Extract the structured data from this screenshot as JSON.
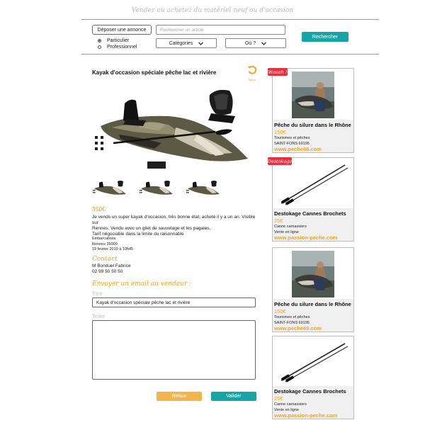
{
  "header": {
    "tagline": "Vendez ou achetez du matériel neuf ou d'occasion",
    "post_ad_label": "Déposer une annonce",
    "search_placeholder": "Rechercher un article",
    "search_button": "Rechercher",
    "category_label": "Catégories",
    "location_label": "Où ?",
    "radio_options": [
      "Particulier",
      "Professionnel"
    ],
    "selected_radio": "Particulier"
  },
  "listing": {
    "title": "Kayak d'occasion spéciale pêche lac et rivière",
    "back_label": "Retour",
    "price": "350€",
    "description": [
      "Je vends un super kayak d'occasion, très bonne état, acheté il y a un an. Visible sur",
      "Rennes. Vendu avec un gilet de sauvetage et les pagaies.",
      "Tarif négociable dans la limite du raisonnable"
    ],
    "category": "Embarcations",
    "location": "Rennes 35000",
    "date": "19 fevrier 2019 à 10h45",
    "contact_heading": "Contact",
    "seller_name": "M Bonduel Fabrice",
    "seller_phone": "02 99 50 50 50"
  },
  "email_form": {
    "heading": "Envoyer un email au vendeur :",
    "title_label": "Titre",
    "title_value": "Kayak d'occasion spéciale pêche lac et rivière",
    "text_label": "Texte",
    "text_value": "",
    "back_button": "Retour",
    "submit_button": "Valider"
  },
  "sidebar": {
    "cards": [
      {
        "badge": "Wouah !",
        "image": "catfish-photo",
        "title": "Pêche du silure dans le Rhône",
        "price": "150€",
        "line1": "Tourismes et pêches",
        "line2": "SAINT-FONS 69195",
        "url": "www.peche69.com"
      },
      {
        "badge": "Destokage",
        "image": "fishing-rod",
        "title": "Destokage Cannes Brochets",
        "price": "25€",
        "line1": "Canne carnassiers",
        "line2": "Vente en ligne",
        "url": "www.passion-peche.com"
      },
      {
        "badge": "",
        "image": "catfish-photo",
        "title": "Pêche du silure dans le Rhône",
        "price": "150€",
        "line1": "Tourismes et pêches",
        "line2": "SAINT-FONS 69195",
        "url": "www.peche69.com"
      },
      {
        "badge": "",
        "image": "fishing-rod",
        "title": "Destokage Cannes Brochets",
        "price": "25€",
        "line1": "Canne carnassiers",
        "line2": "Vente en ligne",
        "url": "www.passion-peche.com"
      }
    ]
  },
  "colors": {
    "accent_orange": "#f2a421",
    "accent_teal": "#16a5a7",
    "badge_red": "#e8303f",
    "button_orange": "#f4b44a"
  }
}
